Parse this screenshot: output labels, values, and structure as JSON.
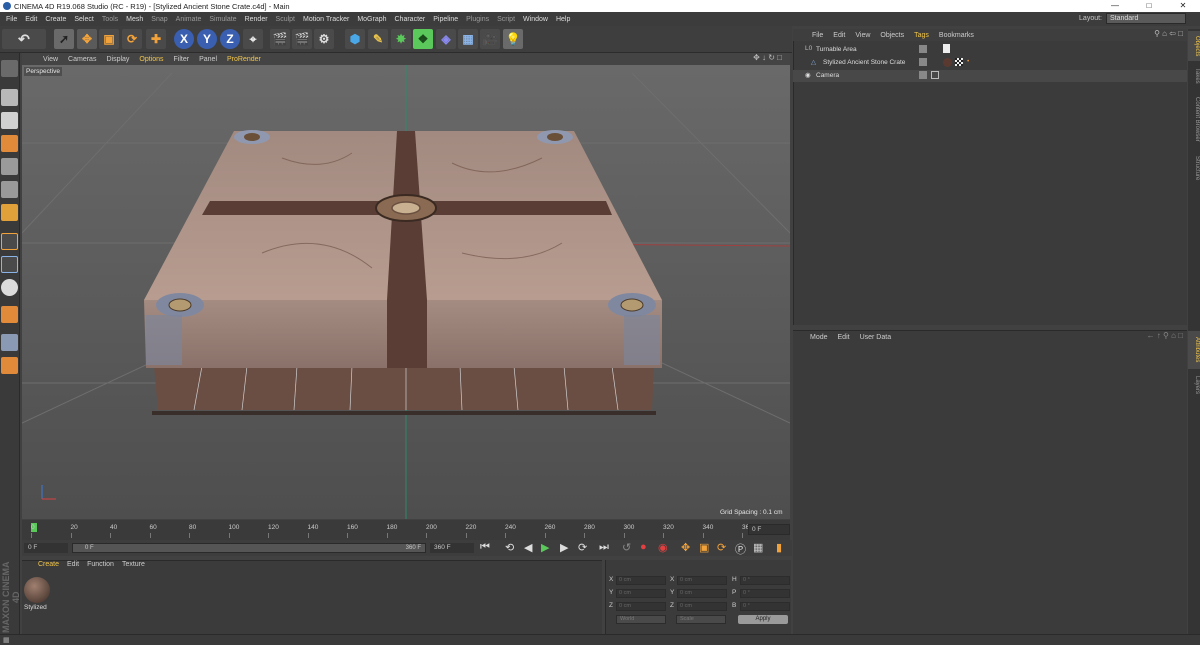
{
  "window": {
    "title": "CINEMA 4D R19.068 Studio (RC - R19) - [Stylized Ancient Stone Crate.c4d] - Main"
  },
  "menubar": {
    "items": [
      "File",
      "Edit",
      "Create",
      "Select",
      "Tools",
      "Mesh",
      "Snap",
      "Animate",
      "Simulate",
      "Render",
      "Sculpt",
      "Motion Tracker",
      "MoGraph",
      "Character",
      "Pipeline",
      "Plugins",
      "Script",
      "Window",
      "Help"
    ],
    "layout_label": "Layout:",
    "layout_value": "Standard"
  },
  "viewport": {
    "menu": [
      "View",
      "Cameras",
      "Display",
      "Options",
      "Filter",
      "Panel",
      "ProRender"
    ],
    "active_menu": "Options",
    "camera_label": "Perspective",
    "grid_spacing": "Grid Spacing : 0.1 cm"
  },
  "timeline": {
    "ticks": [
      "0",
      "20",
      "40",
      "60",
      "80",
      "100",
      "120",
      "140",
      "160",
      "180",
      "200",
      "220",
      "240",
      "260",
      "280",
      "300",
      "320",
      "340",
      "36"
    ],
    "current_frame": "0 F"
  },
  "playback": {
    "start_field": "0 F",
    "range_start": "0 F",
    "range_end": "360 F",
    "end_field": "360 F"
  },
  "object_manager": {
    "menu": [
      "File",
      "Edit",
      "View",
      "Objects",
      "Tags",
      "Bookmarks"
    ],
    "active_menu": "Tags",
    "objects": [
      "Turnable Area",
      "Stylized Ancient Stone Crate",
      "Camera"
    ]
  },
  "attribute_manager": {
    "menu": [
      "Mode",
      "Edit",
      "User Data"
    ]
  },
  "right_tabs": [
    "Objects",
    "Takes",
    "Content Browser",
    "Structure",
    "Attributes",
    "Layers"
  ],
  "material_manager": {
    "menu": [
      "Create",
      "Edit",
      "Function",
      "Texture"
    ],
    "material_name": "Stylized"
  },
  "coordinates": {
    "rows": [
      {
        "a": "X",
        "av": "0 cm",
        "b": "X",
        "bv": "0 cm",
        "c": "H",
        "cv": "0 °"
      },
      {
        "a": "Y",
        "av": "0 cm",
        "b": "Y",
        "bv": "0 cm",
        "c": "P",
        "cv": "0 °"
      },
      {
        "a": "Z",
        "av": "0 cm",
        "b": "Z",
        "bv": "0 cm",
        "c": "B",
        "cv": "0 °"
      }
    ],
    "mode_dropdown": "World",
    "scale_dropdown": "Scale",
    "apply_label": "Apply"
  },
  "branding": "MAXON CINEMA 4D",
  "colors": {
    "accent": "#f2c64a",
    "bg": "#414141",
    "viewport": "#5b5b5b"
  }
}
